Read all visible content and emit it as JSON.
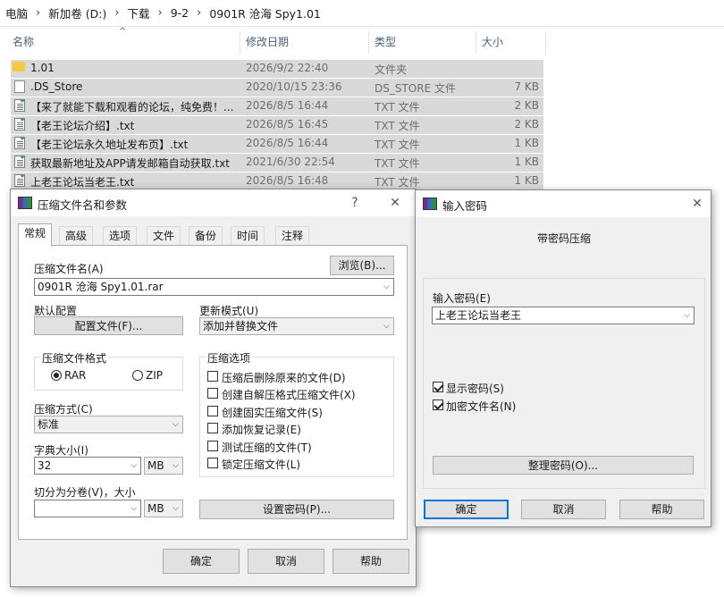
{
  "explorer": {
    "breadcrumbs": [
      "电脑",
      "新加卷 (D:)",
      "下载",
      "9-2",
      "0901R 沧海 Spy1.01"
    ],
    "columns": {
      "name": "名称",
      "date": "修改日期",
      "type": "类型",
      "size": "大小"
    },
    "files": [
      {
        "name": "1.01",
        "date": "2026/9/2 22:40",
        "type": "文件夹",
        "size": "",
        "icon": "folder-icon"
      },
      {
        "name": ".DS_Store",
        "date": "2020/10/15 23:36",
        "type": "DS_STORE 文件",
        "size": "7 KB",
        "icon": "file-icon"
      },
      {
        "name": "【来了就能下载和观看的论坛，纯免费！...",
        "date": "2026/8/5 16:44",
        "type": "TXT 文件",
        "size": "2 KB",
        "icon": "text-file-icon"
      },
      {
        "name": "【老王论坛介绍】.txt",
        "date": "2026/8/5 16:45",
        "type": "TXT 文件",
        "size": "2 KB",
        "icon": "text-file-icon"
      },
      {
        "name": "【老王论坛永久地址发布页】.txt",
        "date": "2026/8/5 16:44",
        "type": "TXT 文件",
        "size": "1 KB",
        "icon": "text-file-icon"
      },
      {
        "name": "获取最新地址及APP请发邮箱自动获取.txt",
        "date": "2021/6/30 22:54",
        "type": "TXT 文件",
        "size": "1 KB",
        "icon": "text-file-icon"
      },
      {
        "name": "上老王论坛当老王.txt",
        "date": "2026/8/5 16:48",
        "type": "TXT 文件",
        "size": "1 KB",
        "icon": "text-file-icon"
      }
    ]
  },
  "archive_dialog": {
    "title": "压缩文件名和参数",
    "help_glyph": "?",
    "close_glyph": "✕",
    "tabs": [
      "常规",
      "高级",
      "选项",
      "文件",
      "备份",
      "时间",
      "注释"
    ],
    "archive_name_label": "压缩文件名(A)",
    "archive_name_value": "0901R 沧海 Spy1.01.rar",
    "browse_button": "浏览(B)...",
    "default_profile_label": "默认配置",
    "profiles_button": "配置文件(F)...",
    "update_mode_label": "更新模式(U)",
    "update_mode_value": "添加并替换文件",
    "format_group_label": "压缩文件格式",
    "format_rar": "RAR",
    "format_zip": "ZIP",
    "method_label": "压缩方式(C)",
    "method_value": "标准",
    "dict_label": "字典大小(I)",
    "dict_value": "32",
    "dict_unit": "MB",
    "split_label": "切分为分卷(V)，大小",
    "split_value": "",
    "split_unit": "MB",
    "options_group_label": "压缩选项",
    "options": [
      {
        "label": "压缩后删除原来的文件(D)",
        "checked": false
      },
      {
        "label": "创建自解压格式压缩文件(X)",
        "checked": false
      },
      {
        "label": "创建固实压缩文件(S)",
        "checked": false
      },
      {
        "label": "添加恢复记录(E)",
        "checked": false
      },
      {
        "label": "测试压缩的文件(T)",
        "checked": false
      },
      {
        "label": "锁定压缩文件(L)",
        "checked": false
      }
    ],
    "set_password_button": "设置密码(P)...",
    "ok_button": "确定",
    "cancel_button": "取消",
    "help_button": "帮助"
  },
  "password_dialog": {
    "title": "输入密码",
    "close_glyph": "✕",
    "heading": "带密码压缩",
    "password_label": "输入密码(E)",
    "password_value": "上老王论坛当老王",
    "show_password_label": "显示密码(S)",
    "encrypt_names_label": "加密文件名(N)",
    "organize_button": "整理密码(O)...",
    "ok_button": "确定",
    "cancel_button": "取消",
    "help_button": "帮助"
  },
  "colors": {
    "selection": "#d9d9d9",
    "dialog_bg": "#f0f0f0",
    "header_text": "#4c607a",
    "focus_border": "#0078d7"
  }
}
